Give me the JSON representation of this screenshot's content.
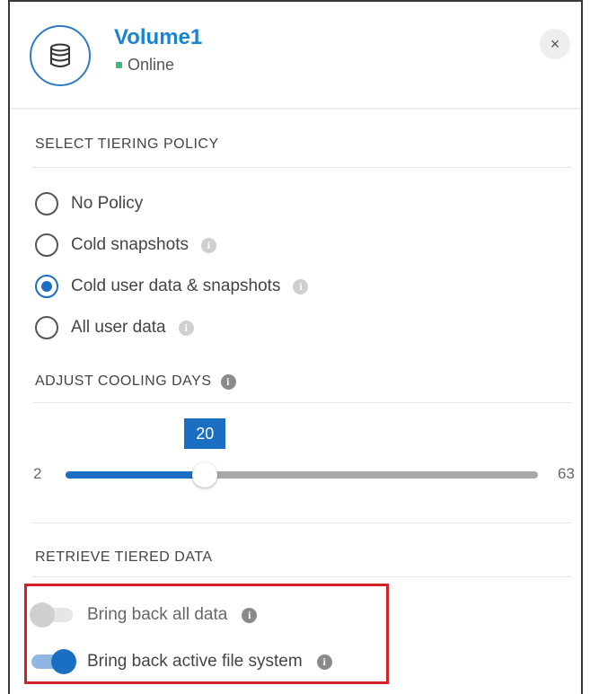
{
  "volume": {
    "name": "Volume1",
    "status": "Online",
    "status_color": "#3cb878",
    "icon": "database-icon"
  },
  "close_icon": "×",
  "tiering": {
    "section_title": "SELECT TIERING POLICY",
    "options": [
      {
        "label": "No Policy",
        "selected": false,
        "info": false
      },
      {
        "label": "Cold snapshots",
        "selected": false,
        "info": true
      },
      {
        "label": "Cold user data & snapshots",
        "selected": true,
        "info": true
      },
      {
        "label": "All user data",
        "selected": false,
        "info": true
      }
    ]
  },
  "cooling": {
    "section_title": "ADJUST COOLING DAYS",
    "min": "2",
    "max": "63",
    "value": "20",
    "min_value": 2,
    "max_value": 63,
    "current_value": 20
  },
  "retrieve": {
    "section_title": "RETRIEVE  TIERED  DATA",
    "toggles": [
      {
        "label": "Bring back all data",
        "on": false
      },
      {
        "label": "Bring back active file system",
        "on": true
      }
    ]
  },
  "colors": {
    "accent": "#1b6fc2",
    "title": "#1b84d0",
    "highlight_border": "#d62027"
  },
  "info_glyph": "i"
}
